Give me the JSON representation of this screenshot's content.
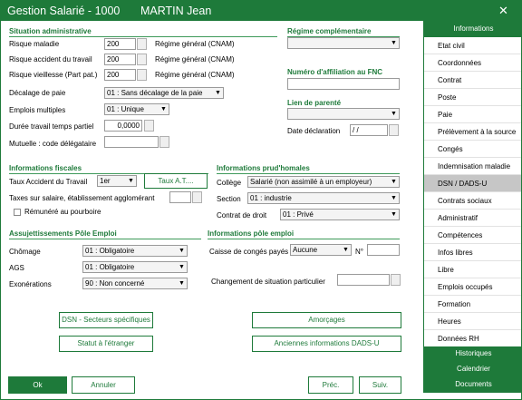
{
  "titlebar": {
    "title": "Gestion Salarié - 1000",
    "employee": "MARTIN Jean",
    "close_glyph": "✕"
  },
  "situation": {
    "title": "Situation administrative",
    "risque_maladie": {
      "label": "Risque maladie",
      "value": "200",
      "regime": "Régime général (CNAM)"
    },
    "risque_accident": {
      "label": "Risque accident du travail",
      "value": "200",
      "regime": "Régime général (CNAM)"
    },
    "risque_vieillesse": {
      "label": "Risque vieillesse (Part pat.)",
      "value": "200",
      "regime": "Régime général (CNAM)"
    },
    "decalage": {
      "label": "Décalage de paie",
      "value": "01 : Sans décalage de la paie"
    },
    "emplois": {
      "label": "Emplois multiples",
      "value": "01 : Unique"
    },
    "duree": {
      "label": "Durée travail temps partiel",
      "value": "0,0000"
    },
    "mutuelle": {
      "label": "Mutuelle : code délégataire",
      "value": ""
    }
  },
  "regime_comp": {
    "title": "Régime complémentaire",
    "value": ""
  },
  "affiliation": {
    "title": "Numéro d'affiliation au FNC",
    "value": ""
  },
  "parente": {
    "title": "Lien de parenté",
    "value": "",
    "date_label": "Date déclaration",
    "date_value": "/ /"
  },
  "fiscales": {
    "title": "Informations fiscales",
    "taux_label": "Taux Accident du Travail",
    "taux_value": "1er",
    "taux_button": "Taux A.T....",
    "taxes_label": "Taxes sur salaire, établissement agglomérant",
    "taxes_value": "",
    "pourboire_label": "Rémunéré au pourboire"
  },
  "prudhomales": {
    "title": "Informations prud'homales",
    "college": {
      "label": "Collège",
      "value": "Salarié (non assimilé à un employeur)"
    },
    "section": {
      "label": "Section",
      "value": "01 : industrie"
    },
    "contrat": {
      "label": "Contrat de droit",
      "value": "01 : Privé"
    }
  },
  "assujettissements": {
    "title": "Assujettissements Pôle Emploi",
    "chomage": {
      "label": "Chômage",
      "value": "01 : Obligatoire"
    },
    "ags": {
      "label": "AGS",
      "value": "01 : Obligatoire"
    },
    "exonerations": {
      "label": "Exonérations",
      "value": "90 : Non concerné"
    }
  },
  "pole_emploi": {
    "title": "Informations pôle emploi",
    "caisse_label": "Caisse de congés payés",
    "caisse_value": "Aucune",
    "numero_label": "N°",
    "numero_value": "",
    "changement_label": "Changement de situation particulier",
    "changement_value": ""
  },
  "buttons": {
    "dsn_secteurs": "DSN - Secteurs spécifiques",
    "statut_etranger": "Statut à l'étranger",
    "amorcages": "Amorçages",
    "anciennes_dads": "Anciennes informations DADS-U",
    "ok": "Ok",
    "annuler": "Annuler",
    "prec": "Préc.",
    "suiv": "Suiv."
  },
  "sidebar": {
    "header": "Informations",
    "items": [
      {
        "label": "Etat civil"
      },
      {
        "label": "Coordonnées"
      },
      {
        "label": "Contrat"
      },
      {
        "label": "Poste"
      },
      {
        "label": "Paie"
      },
      {
        "label": "Prélèvement à la source"
      },
      {
        "label": "Congés"
      },
      {
        "label": "Indemnisation maladie"
      },
      {
        "label": "DSN / DADS-U",
        "active": true
      },
      {
        "label": "Contrats sociaux"
      },
      {
        "label": "Administratif"
      },
      {
        "label": "Compétences"
      },
      {
        "label": "Infos libres"
      },
      {
        "label": "Libre"
      },
      {
        "label": "Emplois occupés"
      },
      {
        "label": "Formation"
      },
      {
        "label": "Heures"
      },
      {
        "label": "Données RH"
      }
    ],
    "footer": {
      "historiques": "Historiques",
      "calendrier": "Calendrier",
      "documents": "Documents"
    }
  },
  "colors": {
    "accent": "#1e7a3a",
    "active_item": "#c6c6c6"
  }
}
